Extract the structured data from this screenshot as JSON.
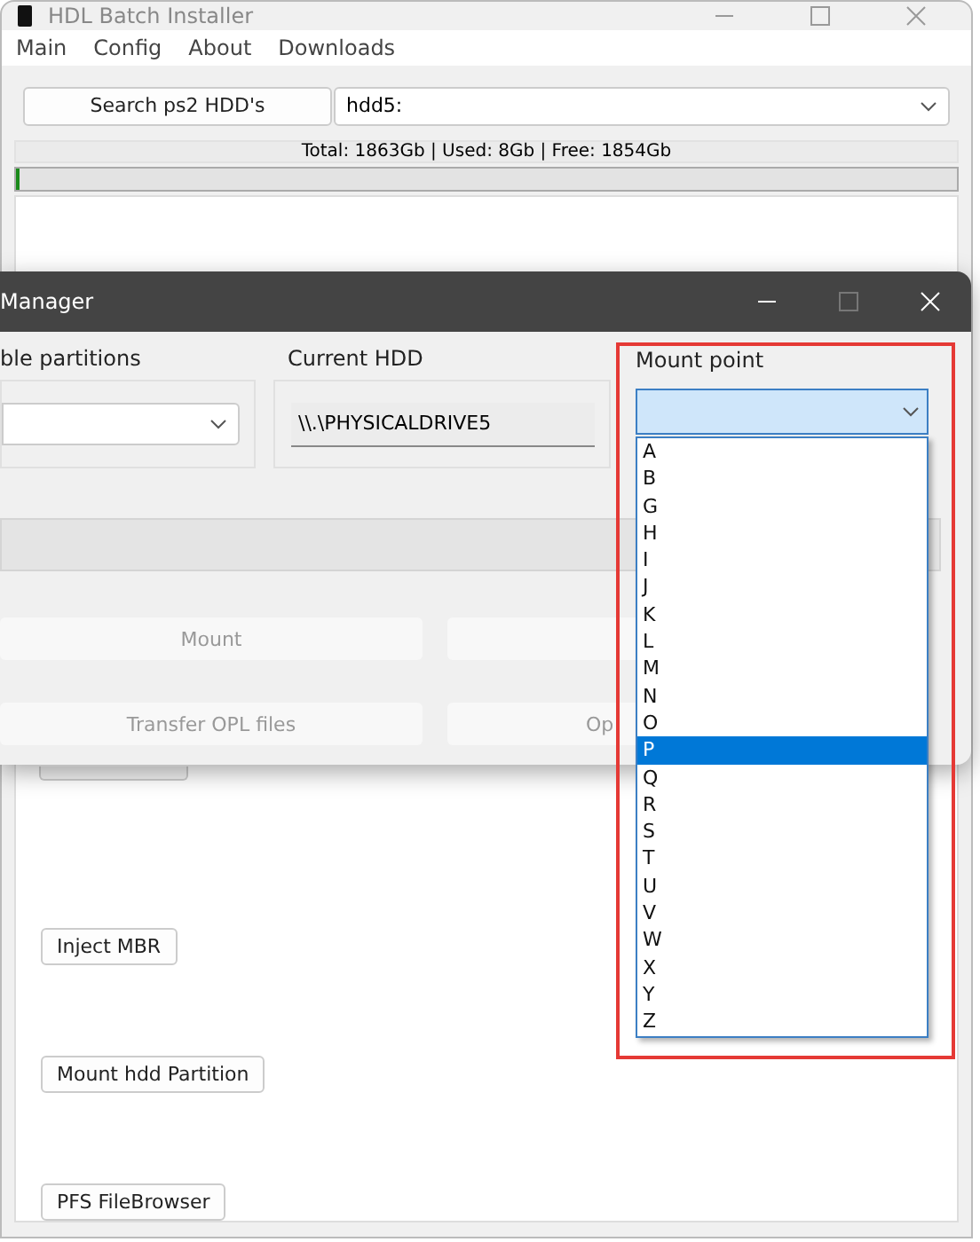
{
  "main_window": {
    "title": "HDL Batch Installer",
    "menu": [
      {
        "label": "Main"
      },
      {
        "label": "Config"
      },
      {
        "label": "About"
      },
      {
        "label": "Downloads"
      }
    ],
    "search_button": "Search ps2 HDD's",
    "hdd_select": {
      "value": "hdd5:"
    },
    "disk_info": "Total: 1863Gb | Used: 8Gb | Free: 1854Gb",
    "progress": {
      "level": 0.004
    },
    "buttons": [
      {
        "label": "Inject MBR"
      },
      {
        "label": "Mount hdd Partition"
      },
      {
        "label": "PFS FileBrowser"
      }
    ]
  },
  "manager_window": {
    "title": "Manager",
    "partitions_group": {
      "label": "ble partitions"
    },
    "current_hdd": {
      "label": "Current HDD",
      "value": "\\\\.\\PHYSICALDRIVE5"
    },
    "mount_point": {
      "label": "Mount point",
      "expanded": true,
      "options": [
        {
          "label": "A",
          "selected": false
        },
        {
          "label": "B",
          "selected": false
        },
        {
          "label": "G",
          "selected": false
        },
        {
          "label": "H",
          "selected": false
        },
        {
          "label": "I",
          "selected": false
        },
        {
          "label": "J",
          "selected": false
        },
        {
          "label": "K",
          "selected": false
        },
        {
          "label": "L",
          "selected": false
        },
        {
          "label": "M",
          "selected": false
        },
        {
          "label": "N",
          "selected": false
        },
        {
          "label": "O",
          "selected": false
        },
        {
          "label": "P",
          "selected": true
        },
        {
          "label": "Q",
          "selected": false
        },
        {
          "label": "R",
          "selected": false
        },
        {
          "label": "S",
          "selected": false
        },
        {
          "label": "T",
          "selected": false
        },
        {
          "label": "U",
          "selected": false
        },
        {
          "label": "V",
          "selected": false
        },
        {
          "label": "W",
          "selected": false
        },
        {
          "label": "X",
          "selected": false
        },
        {
          "label": "Y",
          "selected": false
        },
        {
          "label": "Z",
          "selected": false
        }
      ]
    },
    "buttons": [
      {
        "label": "Mount",
        "disabled": true
      },
      {
        "disabled": true
      },
      {
        "label": "Transfer OPL files",
        "disabled": true
      },
      {
        "label": "Op",
        "disabled": true
      }
    ]
  }
}
